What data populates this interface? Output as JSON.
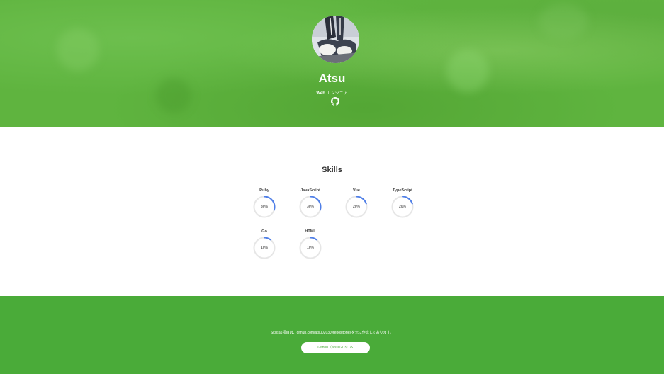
{
  "profile": {
    "name": "Atsu",
    "role_prefix": "Web",
    "role_suffix": "エンジニア",
    "github_icon": "github-icon",
    "avatar_icon": "avatar-photo"
  },
  "skills_section": {
    "title": "Skills",
    "items": [
      {
        "name": "Ruby",
        "percent_label": "30%",
        "percent": 30
      },
      {
        "name": "JavaScript",
        "percent_label": "30%",
        "percent": 30
      },
      {
        "name": "Vue",
        "percent_label": "20%",
        "percent": 20
      },
      {
        "name": "TypeScript",
        "percent_label": "20%",
        "percent": 20
      },
      {
        "name": "Go",
        "percent_label": "10%",
        "percent": 10
      },
      {
        "name": "HTML",
        "percent_label": "10%",
        "percent": 10
      }
    ]
  },
  "footer": {
    "note": "Skillsの項目は、github.com/atsu0203のrepositoriesを元に作成しております。",
    "button_label": "Github（atsu0203）へ"
  },
  "colors": {
    "hero_green": "#5fb43f",
    "footer_green": "#4aab39",
    "ring_accent": "#4f7fe8",
    "ring_track": "#e6e6e6"
  }
}
